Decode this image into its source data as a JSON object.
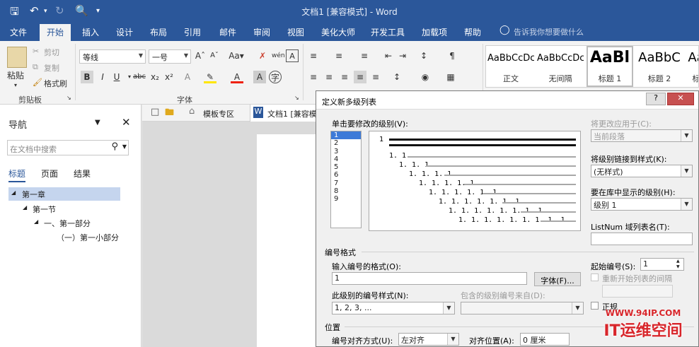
{
  "window": {
    "title": "文档1 [兼容模式] - Word"
  },
  "tabs": [
    "文件",
    "开始",
    "插入",
    "设计",
    "布局",
    "引用",
    "邮件",
    "审阅",
    "视图",
    "美化大师",
    "开发工具",
    "加载项",
    "帮助"
  ],
  "tell_me": "告诉我你想要做什么",
  "clipboard": {
    "paste": "粘贴",
    "cut": "剪切",
    "copy": "复制",
    "format_painter": "格式刷",
    "group": "剪贴板"
  },
  "font": {
    "name": "等线",
    "size": "一号",
    "group": "字体"
  },
  "styles": [
    {
      "sample": "AaBbCcDc",
      "name": "正文"
    },
    {
      "sample": "AaBbCcDc",
      "name": "无间隔"
    },
    {
      "sample": "AaBl",
      "name": "标题 1"
    },
    {
      "sample": "AaBbC",
      "name": "标题 2"
    },
    {
      "sample": "Aa",
      "name": "标"
    }
  ],
  "nav": {
    "title": "导航",
    "search_placeholder": "在文档中搜索",
    "tabs": [
      "标题",
      "页面",
      "结果"
    ],
    "tree": [
      {
        "text": "第一章",
        "level": 0,
        "selected": true
      },
      {
        "text": "第一节",
        "level": 1,
        "selected": false
      },
      {
        "text": "一、第一部分",
        "level": 2,
        "selected": false
      },
      {
        "text": "（一）第一小部分",
        "level": 3,
        "selected": false
      }
    ]
  },
  "doc_tabs": {
    "tab1": "模板专区",
    "tab2": "文档1 [兼容模"
  },
  "dialog": {
    "title": "定义新多级列表",
    "level_label": "单击要修改的级别(V):",
    "levels": [
      "1",
      "2",
      "3",
      "4",
      "5",
      "6",
      "7",
      "8",
      "9"
    ],
    "preview_numbers": [
      "1",
      "1. 1",
      "1. 1. 1",
      "1. 1. 1. 1",
      "1. 1. 1. 1. 1",
      "1. 1. 1. 1. 1. 1",
      "1. 1. 1. 1. 1. 1. 1",
      "1. 1. 1. 1. 1. 1. 1. 1",
      "1. 1. 1. 1. 1. 1. 1. 1. 1"
    ],
    "apply_to_label": "将更改应用于(C):",
    "apply_to_value": "当前段落",
    "link_style_label": "将级别链接到样式(K):",
    "link_style_value": "(无样式)",
    "gallery_level_label": "要在库中显示的级别(H):",
    "gallery_level_value": "级别 1",
    "listnum_label": "ListNum 域列表名(T):",
    "number_format_section": "编号格式",
    "enter_format_label": "输入编号的格式(O):",
    "enter_format_value": "1",
    "font_button": "字体(F)...",
    "style_label": "此级别的编号样式(N):",
    "style_value": "1, 2, 3, ...",
    "include_label": "包含的级别编号来自(D):",
    "start_at_label": "起始编号(S):",
    "start_at_value": "1",
    "restart_label": "重新开始列表的间隔",
    "legal_label": "正规",
    "position_section": "位置",
    "align_label": "编号对齐方式(U):",
    "align_value": "左对齐",
    "align_at_label": "对齐位置(A):",
    "align_at_value": "0 厘米"
  },
  "watermark": {
    "url": "WWW.94IP.COM",
    "brand": "IT运维空间"
  }
}
